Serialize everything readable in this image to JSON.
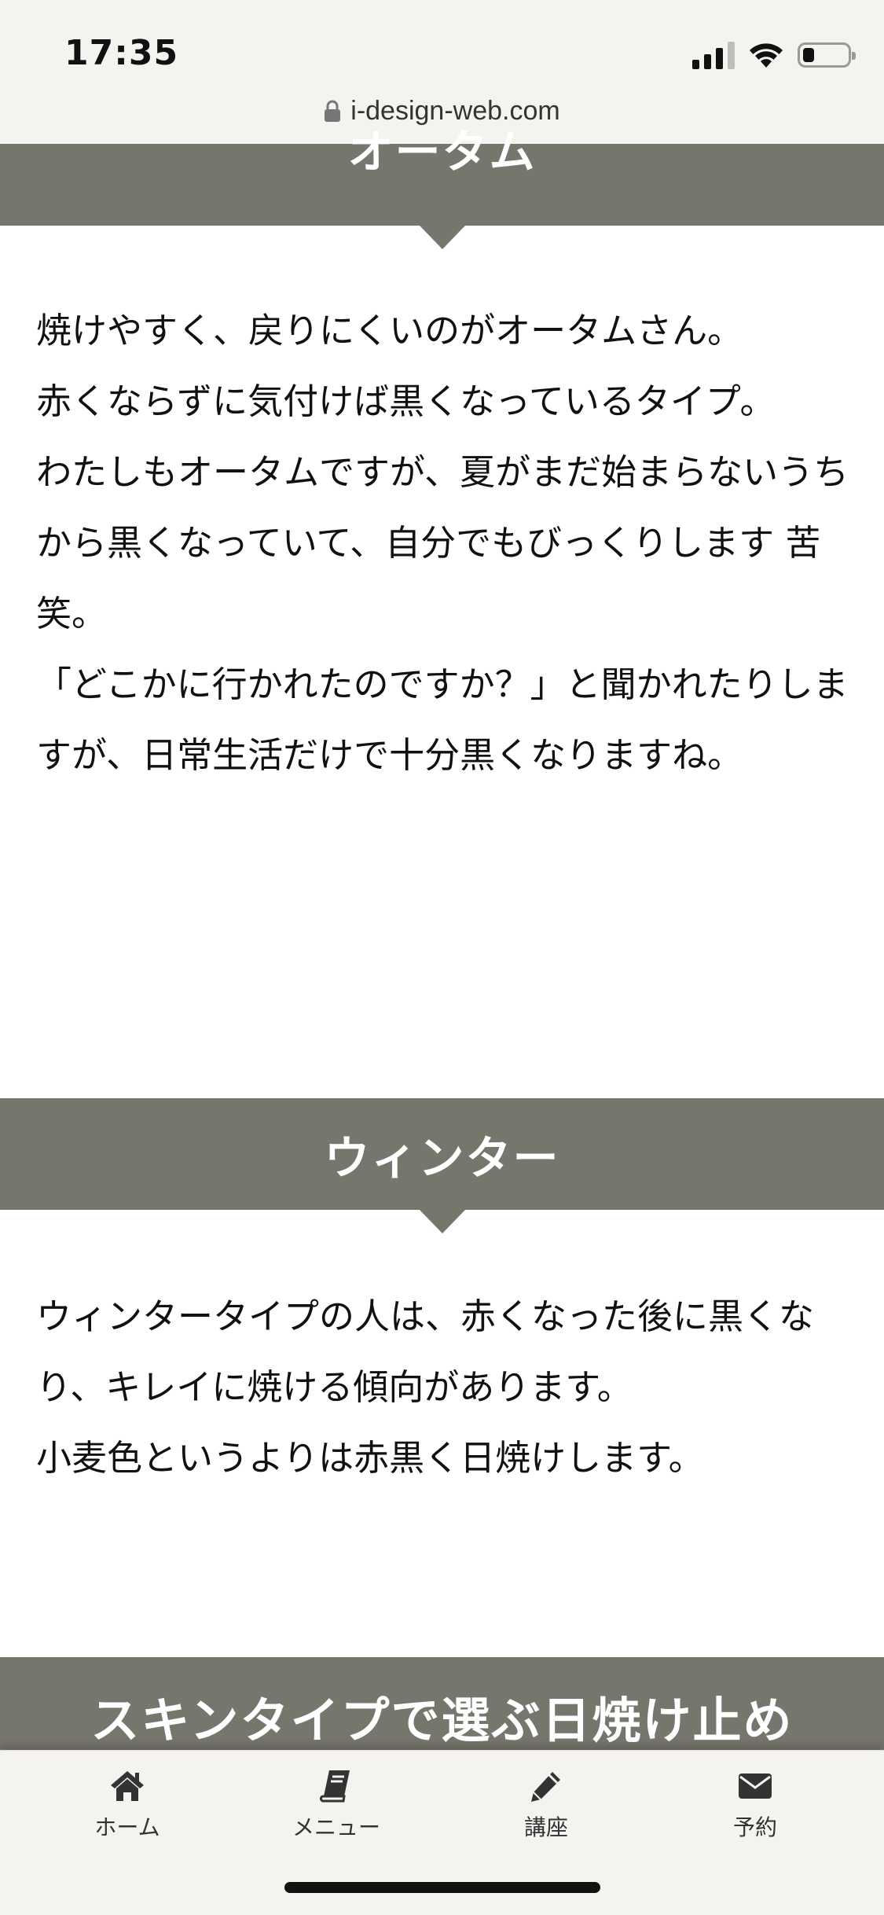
{
  "status_bar": {
    "time": "17:35",
    "icons": [
      "signal-icon",
      "wifi-icon",
      "battery-icon"
    ],
    "battery_level": 0.25
  },
  "browser": {
    "url": "i-design-web.com",
    "lock_icon": "lock-icon"
  },
  "sections": {
    "autumn": {
      "title": "オータム",
      "paragraphs": [
        "焼けやすく、戻りにくいのがオータムさん。",
        "赤くならずに気付けば黒くなっているタイプ。",
        "わたしもオータムですが、夏がまだ始まらないうちから黒くなっていて、自分でもびっくりします 苦笑。",
        "「どこかに行かれたのですか？」と聞かれたりしますが、日常生活だけで十分黒くなりますね。"
      ]
    },
    "winter": {
      "title": "ウィンター",
      "paragraphs": [
        "ウィンタータイプの人は、赤くなった後に黒くなり、キレイに焼ける傾向があります。",
        "小麦色というよりは赤黒く日焼けします。"
      ]
    },
    "skin_type": {
      "title": "スキンタイプで選ぶ日焼け止め"
    }
  },
  "bottom_nav": {
    "items": [
      {
        "label": "ホーム",
        "icon": "home-icon"
      },
      {
        "label": "メニュー",
        "icon": "book-icon"
      },
      {
        "label": "講座",
        "icon": "pencil-icon"
      },
      {
        "label": "予約",
        "icon": "envelope-icon"
      }
    ]
  },
  "colors": {
    "header_bg": "#77766c",
    "chrome_bg": "#f4f3f0",
    "text": "#111111",
    "nav_icon": "#333333"
  }
}
